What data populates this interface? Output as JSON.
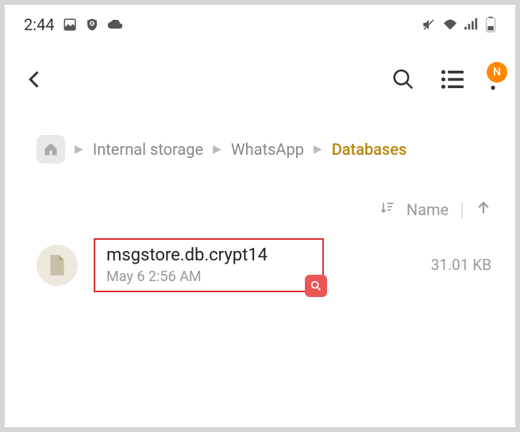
{
  "status": {
    "time": "2:44"
  },
  "breadcrumb": {
    "items": [
      "Internal storage",
      "WhatsApp",
      "Databases"
    ]
  },
  "sort": {
    "label": "Name"
  },
  "files": [
    {
      "name": "msgstore.db.crypt14",
      "date": "May 6 2:56 AM",
      "size": "31.01 KB"
    }
  ],
  "badge": "N"
}
